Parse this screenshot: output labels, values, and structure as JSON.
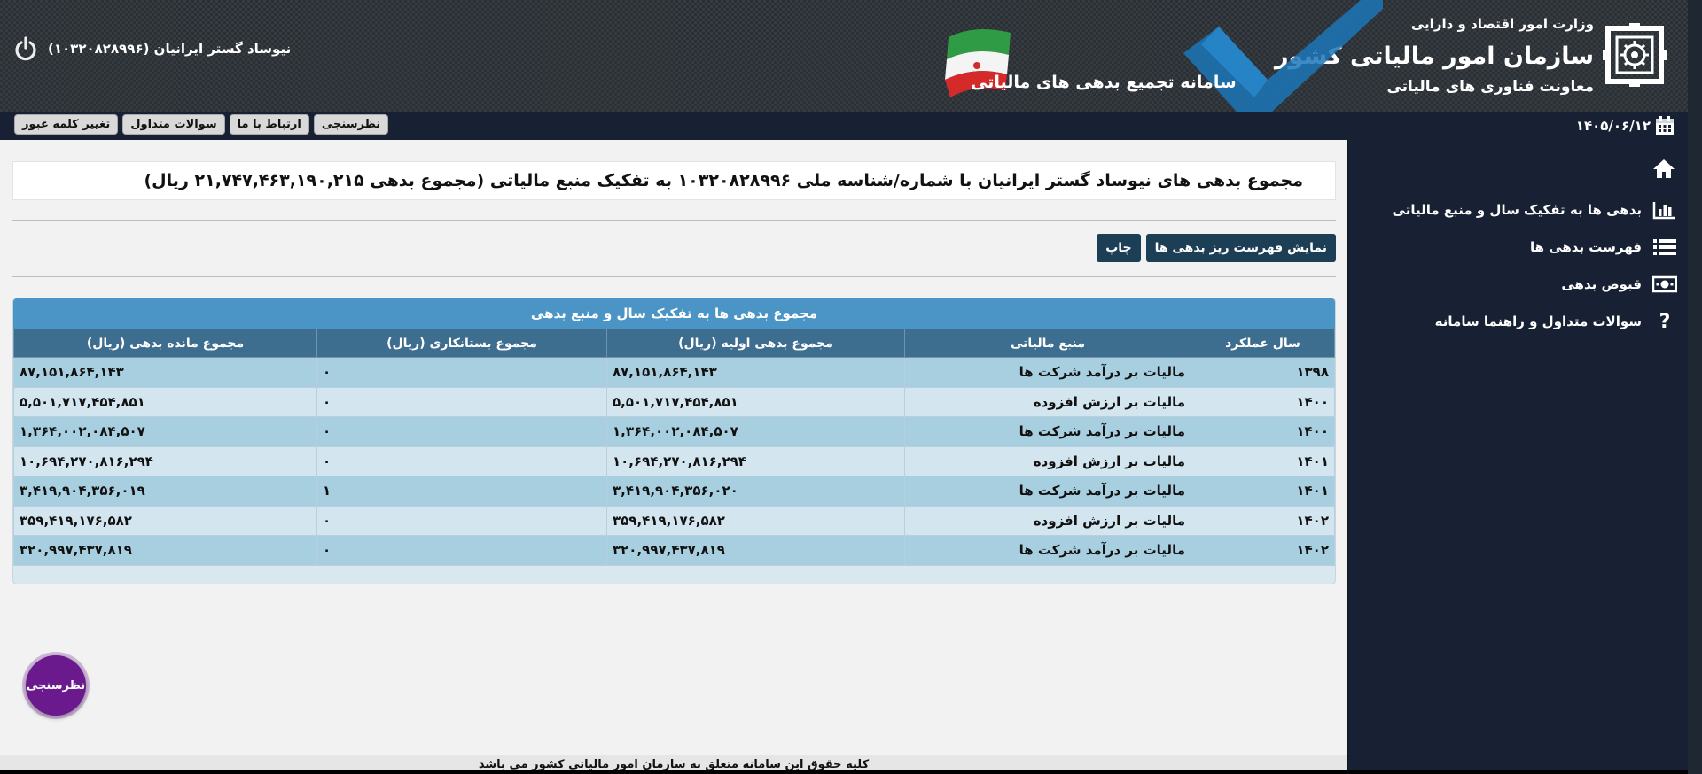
{
  "header": {
    "ministry": "وزارت امور اقتصاد و دارایی",
    "org_name": "سازمان امور مالیاتی کشور",
    "deputy": "معاونت فناوری های مالیاتی",
    "system_title": "سامانه تجمیع بدهی های مالیاتی",
    "user_name": "نیوساد گستر ایرانیان (۱۰۳۲۰۸۲۸۹۹۶)",
    "logout_icon": "power-icon"
  },
  "navbar": {
    "date": "۱۴۰۵/۰۶/۱۲",
    "buttons": [
      "نظرسنجی",
      "ارتباط با ما",
      "سوالات متداول",
      "تغییر کلمه عبور"
    ]
  },
  "sidebar": {
    "home_icon": "home-icon",
    "items": [
      {
        "label": "بدهی ها به تفکیک سال و منبع مالیاتی",
        "icon": "bar-chart-icon"
      },
      {
        "label": "فهرست بدهی ها",
        "icon": "list-icon"
      },
      {
        "label": "قبوض بدهی",
        "icon": "money-icon"
      },
      {
        "label": "سوالات متداول و راهنما سامانه",
        "icon": "question-icon"
      }
    ]
  },
  "main": {
    "title": "مجموع بدهی های نیوساد گستر ایرانیان با شماره/شناسه ملی ۱۰۳۲۰۸۲۸۹۹۶ به تفکیک منبع مالیاتی (مجموع بدهی ۲۱,۷۴۷,۴۶۳,۱۹۰,۲۱۵ ریال)",
    "show_details_button": "نمایش فهرست ریز بدهی ها",
    "print_button": "چاپ",
    "table": {
      "caption": "مجموع بدهی ها به تفکیک سال و منبع بدهی",
      "headers": [
        "سال عملکرد",
        "منبع مالیاتی",
        "مجموع بدهی اولیه (ریال)",
        "مجموع بستانکاری (ریال)",
        "مجموع مانده بدهی (ریال)"
      ],
      "rows": [
        [
          "۱۳۹۸",
          "مالیات بر درآمد شرکت ها",
          "۸۷,۱۵۱,۸۶۴,۱۴۳",
          "۰",
          "۸۷,۱۵۱,۸۶۴,۱۴۳"
        ],
        [
          "۱۴۰۰",
          "مالیات بر ارزش افزوده",
          "۵,۵۰۱,۷۱۷,۴۵۴,۸۵۱",
          "۰",
          "۵,۵۰۱,۷۱۷,۴۵۴,۸۵۱"
        ],
        [
          "۱۴۰۰",
          "مالیات بر درآمد شرکت ها",
          "۱,۳۶۴,۰۰۲,۰۸۴,۵۰۷",
          "۰",
          "۱,۳۶۴,۰۰۲,۰۸۴,۵۰۷"
        ],
        [
          "۱۴۰۱",
          "مالیات بر ارزش افزوده",
          "۱۰,۶۹۴,۲۷۰,۸۱۶,۲۹۴",
          "۰",
          "۱۰,۶۹۴,۲۷۰,۸۱۶,۲۹۴"
        ],
        [
          "۱۴۰۱",
          "مالیات بر درآمد شرکت ها",
          "۳,۴۱۹,۹۰۴,۳۵۶,۰۲۰",
          "۱",
          "۳,۴۱۹,۹۰۴,۳۵۶,۰۱۹"
        ],
        [
          "۱۴۰۲",
          "مالیات بر ارزش افزوده",
          "۳۵۹,۴۱۹,۱۷۶,۵۸۲",
          "۰",
          "۳۵۹,۴۱۹,۱۷۶,۵۸۲"
        ],
        [
          "۱۴۰۲",
          "مالیات بر درآمد شرکت ها",
          "۳۲۰,۹۹۷,۴۳۷,۸۱۹",
          "۰",
          "۳۲۰,۹۹۷,۴۳۷,۸۱۹"
        ]
      ]
    }
  },
  "survey_float": "نظرسنجی",
  "footer": "کلیه حقوق این سامانه متعلق به سازمان امور مالیاتی کشور می باشد",
  "colors": {
    "header_bg": "#2b3036",
    "nav_bg": "#172133",
    "panel_head": "#4a95c6",
    "table_head": "#3d6d8f",
    "row_odd": "#a8cfe0",
    "row_even": "#d3e6f0",
    "action_button": "#1c3f56",
    "survey_purple": "#6a1a8c"
  }
}
